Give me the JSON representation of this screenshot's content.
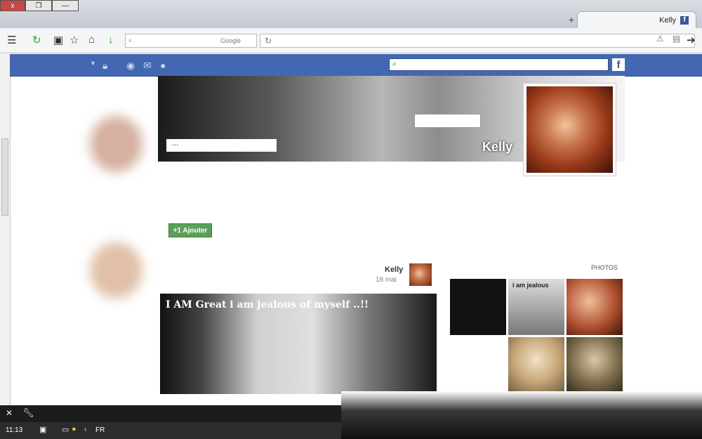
{
  "window": {
    "tab_title": "Kelly",
    "tab_icon": "facebook-f-icon",
    "new_tab": "+",
    "close": "x",
    "search_placeholder": "Google"
  },
  "fbbar": {
    "logo": "f"
  },
  "profile": {
    "name": "Kelly",
    "cover_text": "...",
    "add_button": "+1 Ajouter"
  },
  "post": {
    "author": "Kelly",
    "date": "18 mai",
    "caption": "I AM Great i am jealous of myself ..!!"
  },
  "photos": {
    "title": "PHOTOS",
    "thumb_caption": "i am jealous"
  },
  "taskbar": {
    "time": "11:13",
    "lang": "FR"
  },
  "colors": {
    "facebook_blue": "#4467b1",
    "add_green": "#5aa05a"
  }
}
